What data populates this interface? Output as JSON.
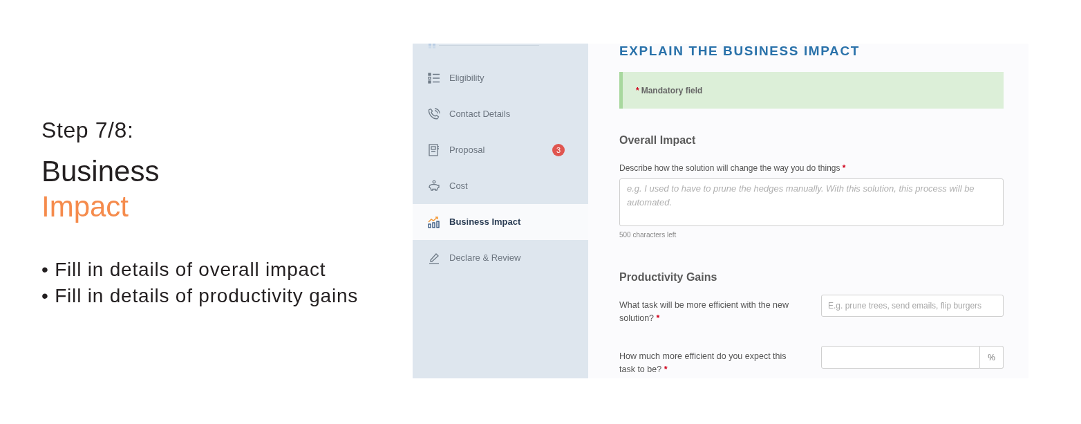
{
  "intro": {
    "step": "Step 7/8:",
    "title_line_1": "Business",
    "title_line_2": "Impact",
    "bullets": [
      "• Fill in details of overall impact",
      "• Fill in details of productivity gains"
    ]
  },
  "sidebar": {
    "items": [
      {
        "label": "Eligibility",
        "selected": false
      },
      {
        "label": "Contact Details",
        "selected": false
      },
      {
        "label": "Proposal",
        "badge": "3",
        "selected": false
      },
      {
        "label": "Cost",
        "selected": false
      },
      {
        "label": "Business Impact",
        "selected": true
      },
      {
        "label": "Declare & Review",
        "selected": false
      }
    ]
  },
  "form": {
    "title": "EXPLAIN THE BUSINESS IMPACT",
    "notice": {
      "mark": "*",
      "text": "Mandatory field"
    },
    "sections": [
      {
        "heading": "Overall Impact",
        "fields": [
          {
            "kind": "textarea",
            "label": "Describe how the solution will change the way you do things",
            "required_mark": "*",
            "placeholder": "e.g. I used to have to prune the hedges manually. With this solution, this process will be automated.",
            "hint": "500 characters left"
          }
        ]
      },
      {
        "heading": "Productivity Gains",
        "fields": [
          {
            "kind": "text",
            "label": "What task will be more efficient with the new solution?",
            "required_mark": "*",
            "placeholder": "E.g. prune trees, send emails, flip burgers"
          },
          {
            "kind": "percent",
            "label": "How much more efficient do you expect this task to be?",
            "required_mark": "*",
            "addon": "%"
          }
        ]
      }
    ]
  }
}
